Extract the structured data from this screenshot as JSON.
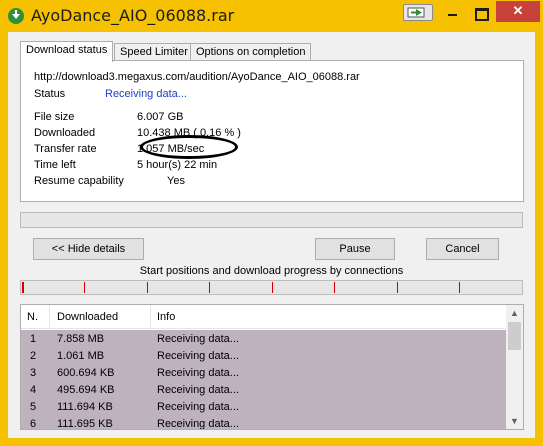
{
  "window": {
    "title": "AyoDance_AIO_06088.rar",
    "close_label": "✕",
    "accent": "#f5c100"
  },
  "tabs": [
    "Download status",
    "Speed Limiter",
    "Options on completion"
  ],
  "status": {
    "url": "http://download3.megaxus.com/audition/AyoDance_AIO_06088.rar",
    "status_label": "Status",
    "status_value": "Receiving data...",
    "file_size_label": "File size",
    "file_size_value": "6.007  GB",
    "downloaded_label": "Downloaded",
    "downloaded_value": "10.438  MB  ( 0.16 % )",
    "transfer_rate_label": "Transfer rate",
    "transfer_rate_value": "1.057  MB/sec",
    "time_left_label": "Time left",
    "time_left_value": "5 hour(s) 22 min",
    "resume_label": "Resume capability",
    "resume_value": "Yes"
  },
  "buttons": {
    "hide_details": "<< Hide details",
    "pause": "Pause",
    "cancel": "Cancel"
  },
  "connections": {
    "caption": "Start positions and download progress by connections"
  },
  "table": {
    "headers": [
      "N.",
      "Downloaded",
      "Info"
    ],
    "rows": [
      {
        "n": "1",
        "downloaded": "7.858  MB",
        "info": "Receiving data..."
      },
      {
        "n": "2",
        "downloaded": "1.061  MB",
        "info": "Receiving data..."
      },
      {
        "n": "3",
        "downloaded": "600.694  KB",
        "info": "Receiving data..."
      },
      {
        "n": "4",
        "downloaded": "495.694  KB",
        "info": "Receiving data..."
      },
      {
        "n": "5",
        "downloaded": "111.694  KB",
        "info": "Receiving data..."
      },
      {
        "n": "6",
        "downloaded": "111.695  KB",
        "info": "Receiving data..."
      }
    ]
  }
}
